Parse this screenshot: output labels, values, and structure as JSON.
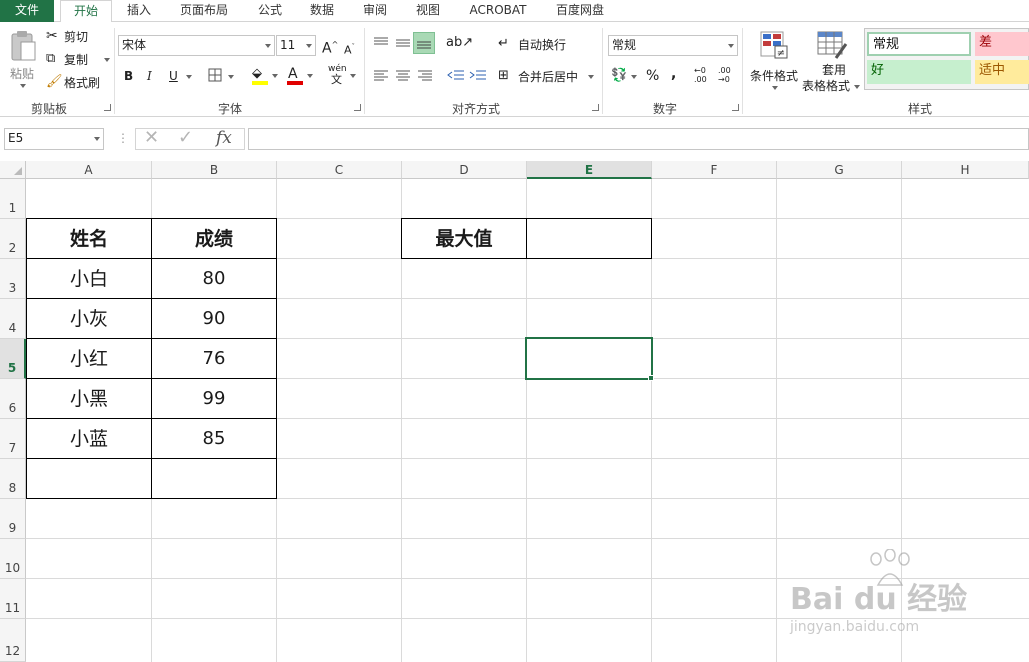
{
  "tabs": {
    "file": "文件",
    "home": "开始",
    "insert": "插入",
    "page_layout": "页面布局",
    "formulas": "公式",
    "data": "数据",
    "review": "审阅",
    "view": "视图",
    "acrobat": "ACROBAT",
    "baidu_pan": "百度网盘"
  },
  "ribbon": {
    "clipboard": {
      "paste": "粘贴",
      "cut": "剪切",
      "copy": "复制",
      "format_painter": "格式刷",
      "label": "剪贴板"
    },
    "font": {
      "name": "宋体",
      "size": "11",
      "grow": "A",
      "shrink": "A",
      "bold": "B",
      "italic": "I",
      "underline": "U",
      "font_color": "A",
      "phonetic": "wén",
      "phonetic_sub": "文",
      "label": "字体"
    },
    "alignment": {
      "wrap_text": "自动换行",
      "merge_center": "合并后居中",
      "label": "对齐方式"
    },
    "number": {
      "format": "常规",
      "percent": "%",
      "comma": ",",
      "inc_decimal": "←0 .00",
      "dec_decimal": ".00 →0",
      "label": "数字"
    },
    "styles": {
      "conditional": "条件格式",
      "table_format_1": "套用",
      "table_format_2": "表格格式",
      "normal": "常规",
      "bad": "差",
      "good": "好",
      "neutral": "适中",
      "label": "样式",
      "colors": {
        "normal_bg": "#ffffff",
        "bad_bg": "#ffc7ce",
        "bad_fg": "#9c0006",
        "good_bg": "#c6efce",
        "good_fg": "#006100",
        "neutral_bg": "#ffeb9c",
        "neutral_fg": "#9c5700"
      }
    }
  },
  "formula_bar": {
    "name_box": "E5",
    "fx": "fx",
    "formula": ""
  },
  "sheet": {
    "columns": [
      "A",
      "B",
      "C",
      "D",
      "E",
      "F",
      "G",
      "H"
    ],
    "rows": [
      "1",
      "2",
      "3",
      "4",
      "5",
      "6",
      "7",
      "8",
      "9",
      "10",
      "11",
      "12"
    ],
    "selected_cell": "E5",
    "table": {
      "header_name": "姓名",
      "header_score": "成绩",
      "rows": [
        {
          "name": "小白",
          "score": "80"
        },
        {
          "name": "小灰",
          "score": "90"
        },
        {
          "name": "小红",
          "score": "76"
        },
        {
          "name": "小黑",
          "score": "99"
        },
        {
          "name": "小蓝",
          "score": "85"
        }
      ]
    },
    "max_label": "最大值",
    "max_value": ""
  },
  "watermark": {
    "brand": "Bai du 经验",
    "url": "jingyan.baidu.com"
  },
  "colors": {
    "accent": "#217346",
    "grid": "#dadada"
  }
}
